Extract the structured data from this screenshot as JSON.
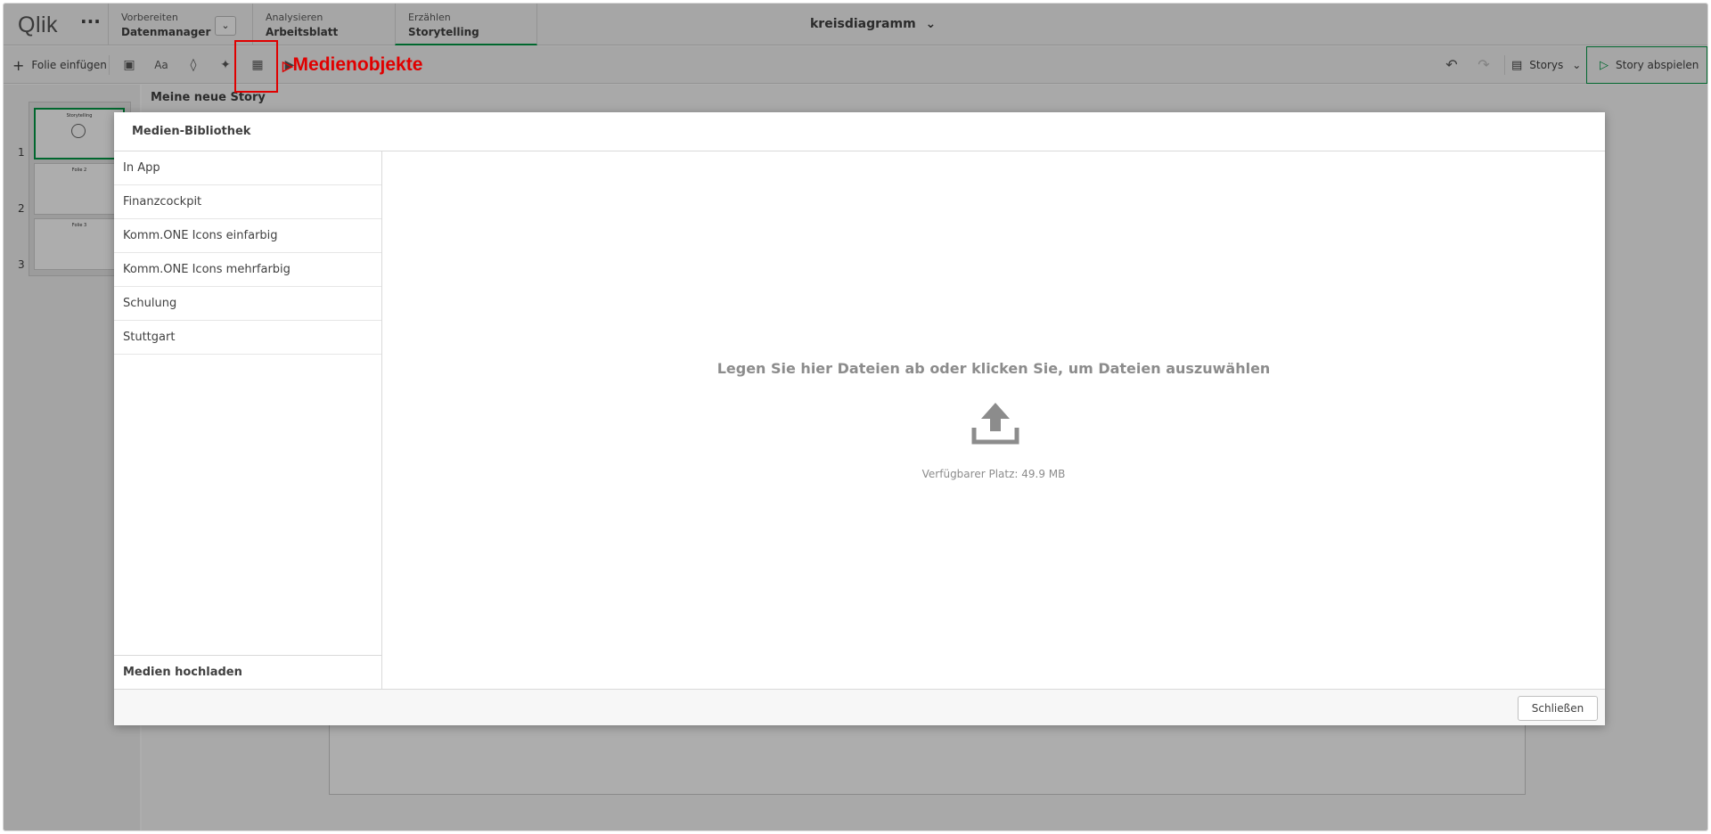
{
  "app": {
    "logo": "Qlik",
    "menu_icon": "more-dots-icon",
    "title": "kreisdiagramm"
  },
  "nav": {
    "tabs": [
      {
        "sub": "Vorbereiten",
        "main": "Datenmanager"
      },
      {
        "sub": "Analysieren",
        "main": "Arbeitsblatt"
      },
      {
        "sub": "Erzählen",
        "main": "Storytelling"
      }
    ]
  },
  "toolbar": {
    "insert_slide": "Folie einfügen",
    "stories_label": "Storys",
    "play_label": "Story abspielen",
    "annotation": "Medienobjekte"
  },
  "story": {
    "title": "Meine neue Story",
    "slides": [
      {
        "num": "1",
        "label": "Storytelling"
      },
      {
        "num": "2",
        "label": "Folie 2"
      },
      {
        "num": "3",
        "label": "Folie 3"
      }
    ]
  },
  "modal": {
    "title": "Medien-Bibliothek",
    "libraries": [
      "In App",
      "Finanzcockpit",
      "Komm.ONE Icons einfarbig",
      "Komm.ONE Icons mehrfarbig",
      "Schulung",
      "Stuttgart"
    ],
    "upload_label": "Medien hochladen",
    "drop_text": "Legen Sie hier Dateien ab oder klicken Sie, um Dateien auszuwählen",
    "available_space": "Verfügbarer Platz: 49.9 MB",
    "close_label": "Schließen"
  },
  "colors": {
    "accent": "#009845",
    "annotation": "#e00000"
  }
}
